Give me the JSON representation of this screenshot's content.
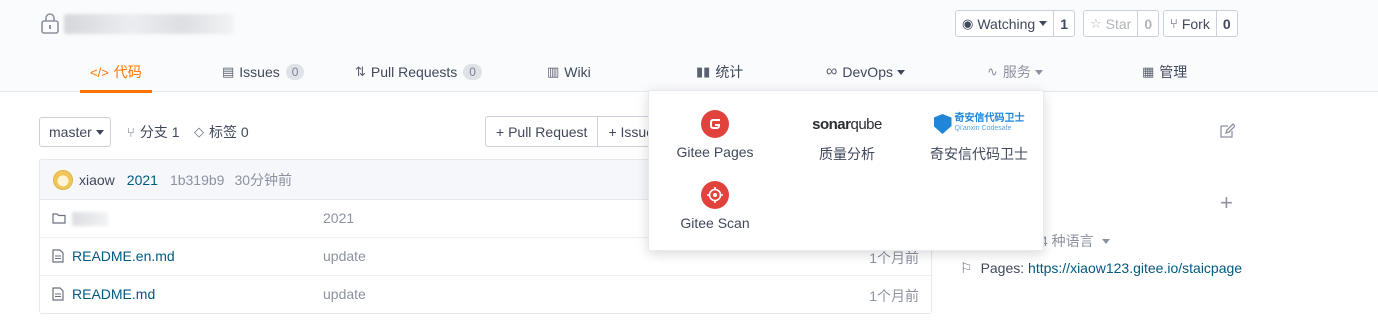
{
  "header": {
    "watching": {
      "label": "Watching",
      "count": "1"
    },
    "star": {
      "label": "Star",
      "count": "0"
    },
    "fork": {
      "label": "Fork",
      "count": "0"
    }
  },
  "tabs": [
    {
      "label": "代码",
      "icon": "code-icon",
      "active": true
    },
    {
      "label": "Issues",
      "badge": "0",
      "icon": "issues-icon"
    },
    {
      "label": "Pull Requests",
      "badge": "0",
      "icon": "pull-request-icon"
    },
    {
      "label": "Wiki",
      "icon": "book-icon"
    },
    {
      "label": "统计",
      "icon": "bar-chart-icon"
    },
    {
      "label": "DevOps",
      "icon": "infinity-icon"
    },
    {
      "label": "服务",
      "icon": "pulse-icon"
    },
    {
      "label": "管理",
      "icon": "settings-doc-icon"
    }
  ],
  "toolbar": {
    "branch": "master",
    "branches_label": "分支 1",
    "tags_label": "标签 0",
    "pull_request": "+ Pull Request",
    "issue": "+ Issue"
  },
  "commit": {
    "author": "xiaow",
    "message": "2021",
    "sha": "1b319b9",
    "time": "30分钟前"
  },
  "files": [
    {
      "type": "folder",
      "name": "",
      "message": "2021",
      "time": ""
    },
    {
      "type": "file",
      "name": "README.en.md",
      "message": "update",
      "time": "1个月前"
    },
    {
      "type": "file",
      "name": "README.md",
      "message": "update",
      "time": "1个月前"
    }
  ],
  "sidebar": {
    "languages": "4 种语言",
    "pages_label": "Pages:",
    "pages_url": "https://xiaow123.gitee.io/staicpage"
  },
  "services_menu": [
    {
      "label": "Gitee Pages",
      "icon": "gitee-pages-icon"
    },
    {
      "label": "质量分析",
      "icon": "sonarqube-logo"
    },
    {
      "label": "奇安信代码卫士",
      "icon": "qianxin-codesafe-logo"
    },
    {
      "label": "Gitee Scan",
      "icon": "gitee-scan-icon"
    }
  ],
  "logos": {
    "sonarqube_bold": "sonar",
    "sonarqube_light": "qube",
    "qax_title": "奇安信代码卫士",
    "qax_sub": "Qi'anxin Codesafe"
  },
  "colors": {
    "accent": "#fe7300",
    "link": "#005980",
    "gitee_red": "#e2423c",
    "qax_blue": "#1f86d8"
  }
}
